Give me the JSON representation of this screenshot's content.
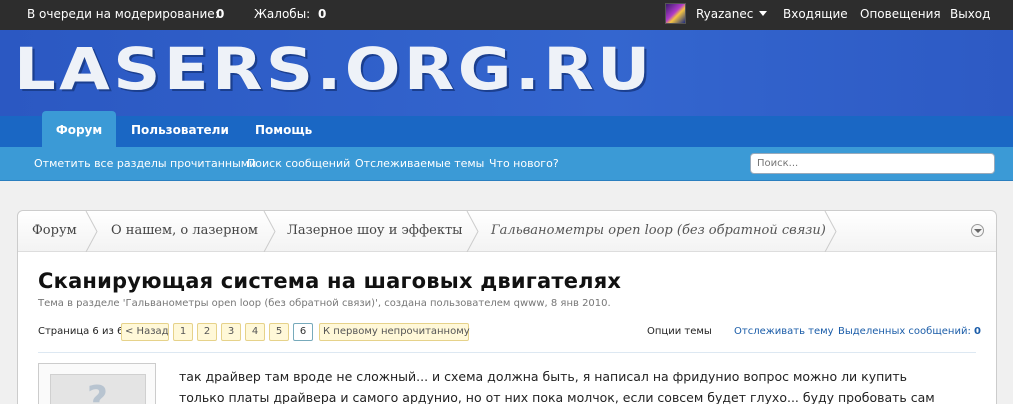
{
  "adminbar": {
    "moderation_label": "В очереди на модерирование:",
    "moderation_count": "0",
    "complaints_label": "Жалобы:",
    "complaints_count": "0",
    "username": "Ryazanec",
    "inbox": "Входящие",
    "alerts": "Оповещения",
    "logout": "Выход"
  },
  "logo": {
    "text": "LASERS.ORG.RU"
  },
  "navtabs": [
    "Форум",
    "Пользователи",
    "Помощь"
  ],
  "subnav": {
    "links": [
      "Отметить все разделы прочитанными",
      "Поиск сообщений",
      "Отслеживаемые темы",
      "Что нового?"
    ],
    "search_placeholder": "Поиск..."
  },
  "breadcrumbs": [
    "Форум",
    "О нашем, о лазерном",
    "Лазерное шоу и эффекты",
    "Гальванометры open loop (без обратной связи)"
  ],
  "thread": {
    "title": "Сканирующая система на шаговых двигателях",
    "meta": "Тема в разделе 'Гальванометры open loop (без обратной связи)', создана пользователем qwww, 8 янв 2010."
  },
  "pager": {
    "label": "Страница 6 из 6",
    "prev": "< Назад",
    "pages": [
      "1",
      "2",
      "3",
      "4",
      "5",
      "6"
    ],
    "current": "6",
    "first_unread": "К первому непрочитанному"
  },
  "thread_options": {
    "options": "Опции темы",
    "watch": "Отслеживать тему",
    "selected_label": "Выделенных сообщений:",
    "selected_count": "0"
  },
  "post": {
    "lines": [
      "так драйвер там вроде не сложный... и схема должна быть, я написал на фридунио вопрос можно ли купить",
      "только платы драйвера и самого ардунио, но от них пока молчок, если совсем будет глухо... буду пробовать сам"
    ]
  },
  "colors": {
    "adminbar": "#2d2d2d",
    "logo_band": "#2a5fc9",
    "navtabs": "#1a67c4",
    "subnav": "#3b9ad6",
    "page_bg": "#f0f0f0"
  }
}
